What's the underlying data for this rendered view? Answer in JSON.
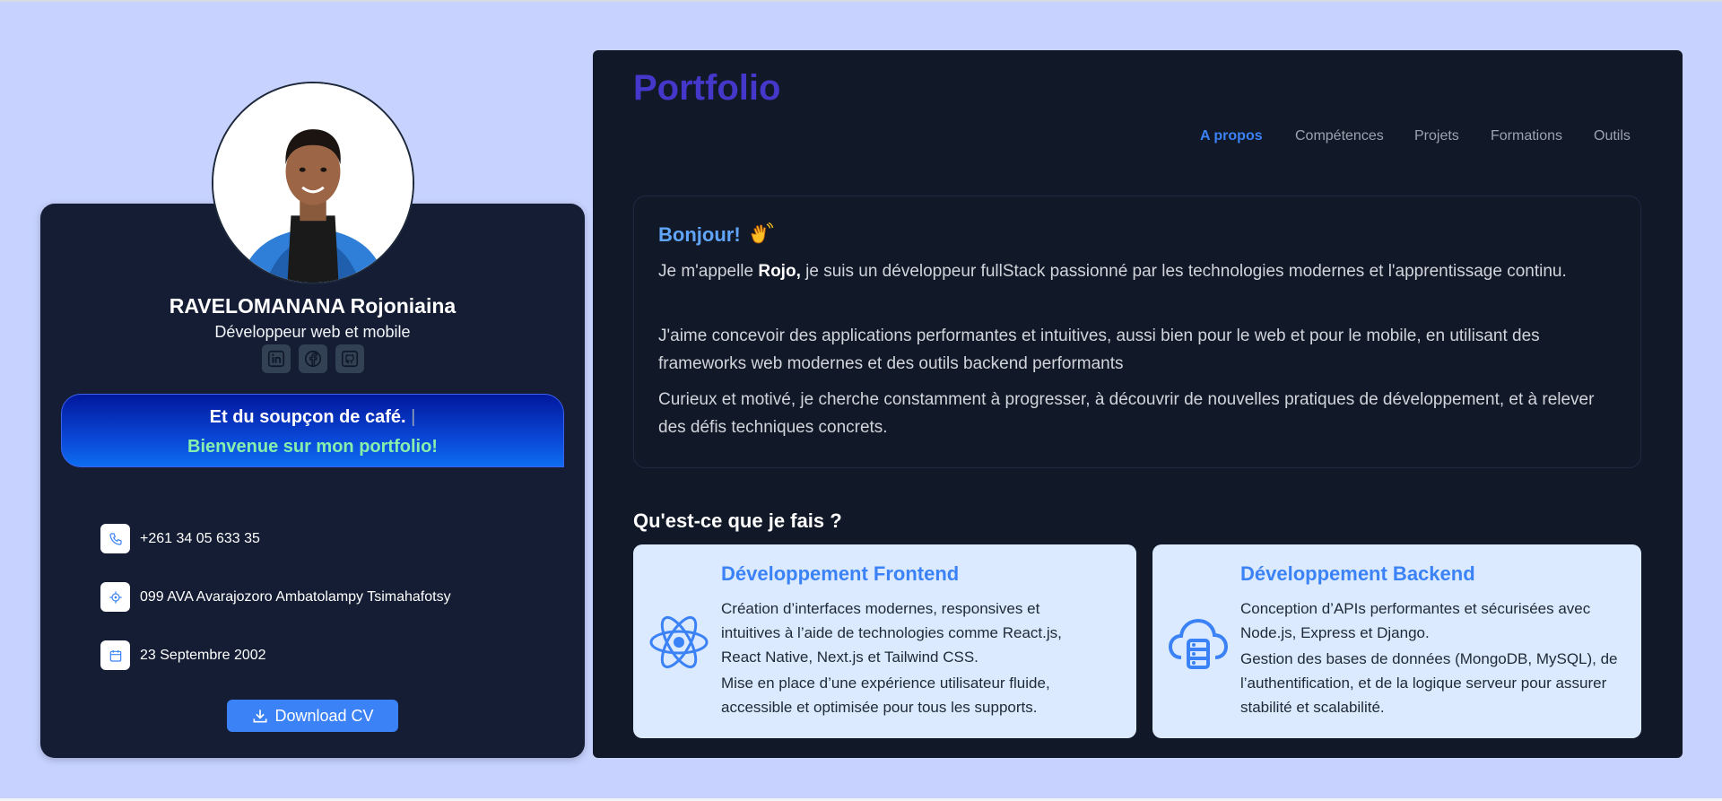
{
  "profile": {
    "name": "RAVELOMANANA Rojoniaina",
    "role": "Développeur web et mobile",
    "socials": [
      {
        "icon": "linkedin-icon"
      },
      {
        "icon": "facebook-icon"
      },
      {
        "icon": "github-icon"
      }
    ],
    "banner": {
      "line1": "Et du soupçon de café.",
      "cursor": "|",
      "line2": "Bienvenue sur mon portfolio!"
    },
    "contacts": {
      "phone": "+261 34 05 633 35",
      "address": "099 AVA Avarajozoro Ambatolampy Tsimahafotsy",
      "birthdate": "23 Septembre 2002"
    },
    "download_label": "Download CV"
  },
  "header": {
    "title": "Portfolio",
    "nav": {
      "about": "A propos",
      "skills": "Compétences",
      "projects": "Projets",
      "education": "Formations",
      "tools": "Outils"
    },
    "active_nav": "A propos"
  },
  "about": {
    "greeting": "Bonjour!",
    "p1_pre": "Je m'appelle ",
    "p1_name": "Rojo,",
    "p1_post": " je suis un développeur fullStack passionné par les technologies modernes et l'apprentissage continu.",
    "p2": "J'aime concevoir des applications performantes et intuitives, aussi bien pour le web et pour le mobile, en utilisant des frameworks web modernes et des outils backend performants",
    "p3": "Curieux et motivé, je cherche constamment à progresser, à découvrir de nouvelles pratiques de développement, et à relever des défis techniques concrets."
  },
  "services": {
    "title": "Qu'est-ce que je fais ?",
    "frontend": {
      "icon": "react-icon",
      "title": "Développement Frontend",
      "text1": "Création d’interfaces modernes, responsives et intuitives à l’aide de technologies comme React.js, React Native, Next.js et Tailwind CSS.",
      "text2": "Mise en place d’une expérience utilisateur fluide, accessible et optimisée pour tous les supports."
    },
    "backend": {
      "icon": "cloud-server-icon",
      "title": "Développement Backend",
      "text1": "Conception d’APIs performantes et sécurisées avec Node.js, Express et Django.",
      "text2": "Gestion des bases de données (MongoDB, MySQL), de l’authentification, et de la logique serveur pour assurer stabilité et scalabilité."
    }
  },
  "colors": {
    "page_bg": "#c7d2fe",
    "card_bg": "#141d33",
    "panel_bg": "#111827",
    "accent": "#3b82f6",
    "title": "#4338ca",
    "service_bg": "#dbeafe",
    "banner_green": "#86efac"
  }
}
